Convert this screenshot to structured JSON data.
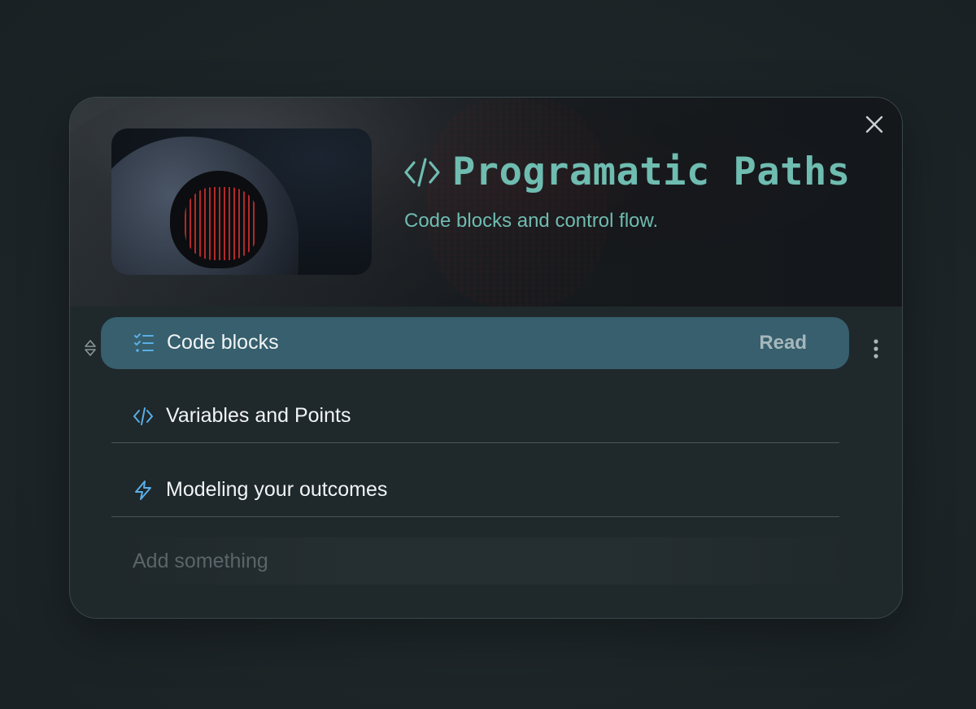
{
  "header": {
    "title": "Programatic Paths",
    "subtitle": "Code blocks and control flow.",
    "title_icon": "code-icon",
    "close_icon": "close-icon"
  },
  "items": [
    {
      "label": "Code blocks",
      "icon": "checklist-icon",
      "action": "Read",
      "selected": true
    },
    {
      "label": "Variables and Points",
      "icon": "code-icon",
      "selected": false
    },
    {
      "label": "Modeling your outcomes",
      "icon": "lightning-icon",
      "selected": false
    }
  ],
  "add": {
    "placeholder": "Add something",
    "value": ""
  },
  "colors": {
    "accent_teal": "#6fbcb1",
    "selected_row": "#375f6d",
    "icon_blue": "#5aaee6",
    "card_bg": "#1f282b"
  }
}
